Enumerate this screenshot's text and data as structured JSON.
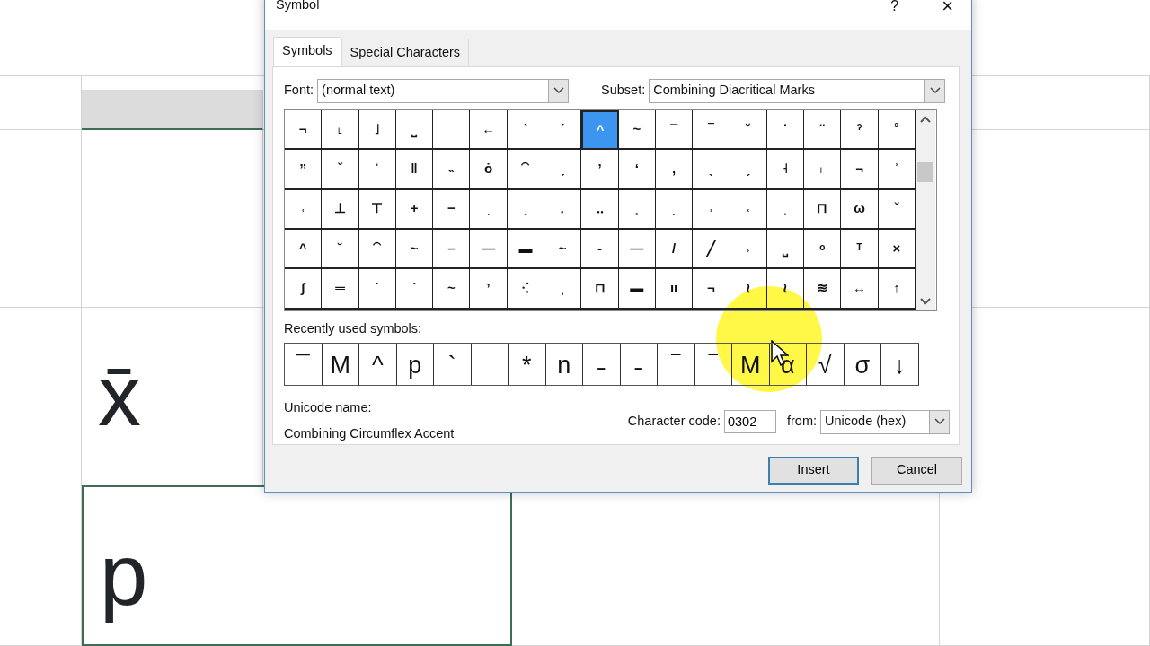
{
  "sheet": {
    "cells": [
      {
        "text": "x̄"
      },
      {
        "text": "p",
        "selected": true
      }
    ]
  },
  "dialog": {
    "title": "Symbol",
    "help": "?",
    "close": "×",
    "tabs": [
      {
        "label": "Symbols",
        "selected": true
      },
      {
        "label": "Special Characters",
        "selected": false
      }
    ],
    "font": {
      "label": "Font:",
      "value": "(normal text)"
    },
    "subset": {
      "label": "Subset:",
      "value": "Combining Diacritical Marks"
    },
    "grid": [
      [
        {
          "c": "¬",
          "selected": false
        },
        {
          "c": "˪",
          "selected": false
        },
        {
          "c": "˩",
          "selected": false
        },
        {
          "c": "⎵",
          "selected": false
        },
        {
          "c": "_",
          "selected": false
        },
        {
          "c": "←",
          "selected": false
        },
        {
          "c": "ˋ",
          "selected": false
        },
        {
          "c": "ˊ",
          "selected": false
        },
        {
          "c": "^",
          "selected": true
        },
        {
          "c": "~",
          "selected": false
        },
        {
          "c": "¯",
          "selected": false
        },
        {
          "c": "‾",
          "selected": false
        },
        {
          "c": "˘",
          "selected": false
        },
        {
          "c": "˙",
          "selected": false
        },
        {
          "c": "¨",
          "selected": false
        },
        {
          "c": "ˀ",
          "selected": false
        },
        {
          "c": "˚",
          "selected": false
        }
      ],
      [
        {
          "c": "ˮ",
          "selected": false
        },
        {
          "c": "ˇ",
          "selected": false
        },
        {
          "c": "ˈ",
          "selected": false
        },
        {
          "c": "‖",
          "selected": false
        },
        {
          "c": "˵",
          "selected": false
        },
        {
          "c": "ȯ",
          "selected": false
        },
        {
          "c": "⁀",
          "selected": false
        },
        {
          "c": "ˏ",
          "selected": false
        },
        {
          "c": "ʼ",
          "selected": false
        },
        {
          "c": "ʻ",
          "selected": false
        },
        {
          "c": "‚",
          "selected": false
        },
        {
          "c": "ˎ",
          "selected": false
        },
        {
          "c": "ˏ",
          "selected": false
        },
        {
          "c": "˧",
          "selected": false
        },
        {
          "c": "˫",
          "selected": false
        },
        {
          "c": "¬",
          "selected": false
        },
        {
          "c": "ʾ",
          "selected": false
        }
      ],
      [
        {
          "c": "˓",
          "selected": false
        },
        {
          "c": "⊥",
          "selected": false
        },
        {
          "c": "⊤",
          "selected": false
        },
        {
          "c": "+",
          "selected": false
        },
        {
          "c": "−",
          "selected": false
        },
        {
          "c": "˯",
          "selected": false
        },
        {
          "c": "˰",
          "selected": false
        },
        {
          "c": "․",
          "selected": false
        },
        {
          "c": "‥",
          "selected": false
        },
        {
          "c": "˳",
          "selected": false
        },
        {
          "c": "ˏ",
          "selected": false
        },
        {
          "c": "˒",
          "selected": false
        },
        {
          "c": "˓",
          "selected": false
        },
        {
          "c": "ˌ",
          "selected": false
        },
        {
          "c": "⊓",
          "selected": false
        },
        {
          "c": "ω",
          "selected": false
        },
        {
          "c": "ˇ",
          "selected": false
        }
      ],
      [
        {
          "c": "^",
          "selected": false
        },
        {
          "c": "˘",
          "selected": false
        },
        {
          "c": "⁀",
          "selected": false
        },
        {
          "c": "~",
          "selected": false
        },
        {
          "c": "–",
          "selected": false
        },
        {
          "c": "—",
          "selected": false
        },
        {
          "c": "▬",
          "selected": false
        },
        {
          "c": "~",
          "selected": false
        },
        {
          "c": "-",
          "selected": false
        },
        {
          "c": "—",
          "selected": false
        },
        {
          "c": "/",
          "selected": false
        },
        {
          "c": "╱",
          "selected": false
        },
        {
          "c": "˒",
          "selected": false
        },
        {
          "c": "⎵",
          "selected": false
        },
        {
          "c": "ᵒ",
          "selected": false
        },
        {
          "c": "ᵀ",
          "selected": false
        },
        {
          "c": "×",
          "selected": false
        }
      ],
      [
        {
          "c": "ʃ",
          "selected": false
        },
        {
          "c": "═",
          "selected": false
        },
        {
          "c": "ˋ",
          "selected": false
        },
        {
          "c": "ˊ",
          "selected": false
        },
        {
          "c": "~",
          "selected": false
        },
        {
          "c": "ʼ",
          "selected": false
        },
        {
          "c": "⁖",
          "selected": false
        },
        {
          "c": "ˌ",
          "selected": false
        },
        {
          "c": "⊓",
          "selected": false
        },
        {
          "c": "▬",
          "selected": false
        },
        {
          "c": "ıı",
          "selected": false
        },
        {
          "c": "¬",
          "selected": false
        },
        {
          "c": "≀",
          "selected": false
        },
        {
          "c": "≀",
          "selected": false
        },
        {
          "c": "≋",
          "selected": false
        },
        {
          "c": "↔",
          "selected": false
        },
        {
          "c": "↑",
          "selected": false
        }
      ]
    ],
    "recent_label": "Recently used symbols:",
    "recent": [
      {
        "kind": "symbol",
        "c": "¯"
      },
      {
        "kind": "symbol",
        "c": "M"
      },
      {
        "kind": "symbol",
        "c": "^"
      },
      {
        "kind": "symbol",
        "c": "p"
      },
      {
        "kind": "symbol",
        "c": "`"
      },
      {
        "kind": "empty"
      },
      {
        "kind": "symbol",
        "c": "*"
      },
      {
        "kind": "symbol",
        "c": "n"
      },
      {
        "kind": "symbol",
        "c": "˗"
      },
      {
        "kind": "symbol",
        "c": "˗"
      },
      {
        "kind": "symbol",
        "c": "‾"
      },
      {
        "kind": "symbol",
        "c": "‾"
      },
      {
        "kind": "symbol",
        "c": "M"
      },
      {
        "kind": "symbol",
        "c": "α"
      },
      {
        "kind": "symbol",
        "c": "√"
      },
      {
        "kind": "symbol",
        "c": "σ"
      },
      {
        "kind": "symbol",
        "c": "↓"
      }
    ],
    "unicode_label": "Unicode name:",
    "unicode_name": "Combining Circumflex Accent",
    "code_label": "Character code:",
    "code_value": "0302",
    "from_label": "from:",
    "from_value": "Unicode (hex)",
    "buttons": [
      {
        "label": "Insert",
        "default": true
      },
      {
        "label": "Cancel",
        "default": false
      }
    ]
  }
}
